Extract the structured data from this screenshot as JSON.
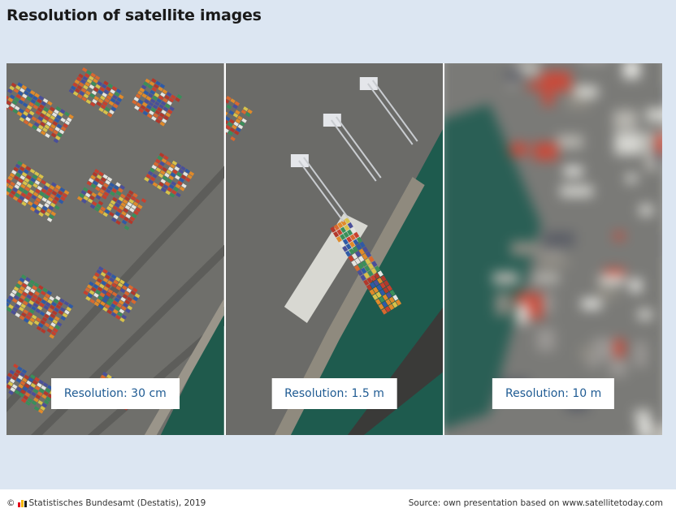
{
  "title": "Resolution of satellite images",
  "panels": [
    {
      "label": "Resolution: 30 cm"
    },
    {
      "label": "Resolution: 1.5 m"
    },
    {
      "label": "Resolution: 10 m"
    }
  ],
  "footer": {
    "copyright_symbol": "©",
    "copyright_text": "Statistisches Bundesamt (Destatis), 2019",
    "source": "Source: own presentation based on www.satellitetoday.com"
  },
  "colors": {
    "background": "#dce6f2",
    "label_text": "#1f5b93",
    "water": "#1f5a4c",
    "pavement": "#6e6e6a",
    "logo": [
      "#e3051b",
      "#f7b500",
      "#1d1d1b"
    ]
  }
}
